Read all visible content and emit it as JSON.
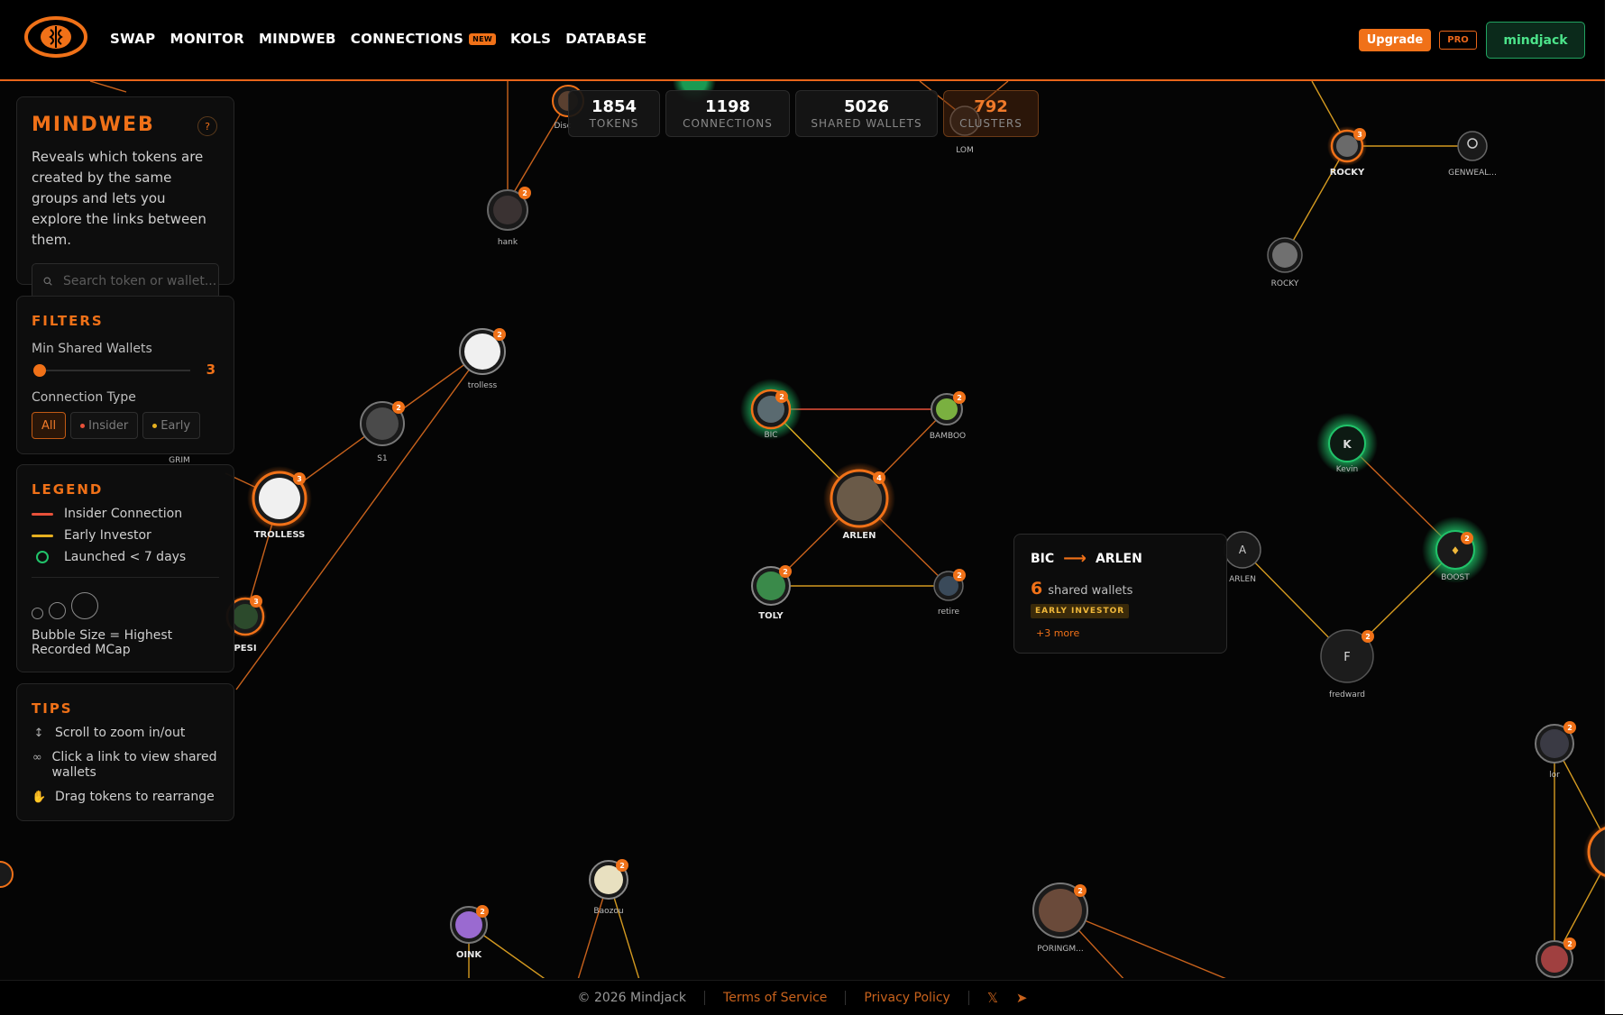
{
  "header": {
    "nav": [
      {
        "label": "SWAP"
      },
      {
        "label": "MONITOR"
      },
      {
        "label": "MINDWEB"
      },
      {
        "label": "CONNECTIONS",
        "badge": "NEW"
      },
      {
        "label": "KOLS"
      },
      {
        "label": "DATABASE"
      }
    ],
    "upgrade_label": "Upgrade",
    "pro_label": "PRO",
    "user_label": "mindjack"
  },
  "stats": [
    {
      "value": "1854",
      "label": "TOKENS"
    },
    {
      "value": "1198",
      "label": "CONNECTIONS"
    },
    {
      "value": "5026",
      "label": "SHARED WALLETS"
    },
    {
      "value": "792",
      "label": "CLUSTERS"
    }
  ],
  "mindweb": {
    "title": "MINDWEB",
    "help": "?",
    "description": "Reveals which tokens are created by the same groups and lets you explore the links between them.",
    "search_placeholder": "Search token or wallet..."
  },
  "filters": {
    "title": "FILTERS",
    "min_shared_label": "Min Shared Wallets",
    "min_shared_value": "3",
    "connection_type_label": "Connection Type",
    "types": [
      {
        "label": "All"
      },
      {
        "label": "Insider"
      },
      {
        "label": "Early"
      }
    ]
  },
  "legend": {
    "title": "LEGEND",
    "items": [
      {
        "label": "Insider Connection"
      },
      {
        "label": "Early Investor"
      },
      {
        "label": "Launched < 7 days"
      }
    ],
    "bubble_note": "Bubble Size = Highest Recorded MCap"
  },
  "tips": {
    "title": "TIPS",
    "items": [
      {
        "label": "Scroll to zoom in/out"
      },
      {
        "label": "Click a link to view shared wallets"
      },
      {
        "label": "Drag tokens to rearrange"
      }
    ]
  },
  "tooltip": {
    "from": "BIC",
    "to": "ARLEN",
    "count": "6",
    "count_label": "shared wallets",
    "tag": "EARLY INVESTOR",
    "more": "+3 more"
  },
  "nodes": {
    "hank": "hank",
    "lom": "LOM",
    "disc": "Disc",
    "rocky1": "ROCKY",
    "genweal": "GENWEAL...",
    "rocky2": "ROCKY",
    "trolless": "trolless",
    "s1": "S1",
    "grim": "GRIM",
    "trolless2": "TROLLESS",
    "pepe": "PESI",
    "bic": "BIC",
    "bamboo": "BAMBOO",
    "arlen": "ARLEN",
    "toly": "TOLY",
    "retire": "retire",
    "kevin": "Kevin",
    "arlen2": "ARLEN",
    "boost": "BOOST",
    "fredward": "fredward",
    "lor": "lor",
    "oink": "OINK",
    "baozou": "Baozou",
    "poringm": "PORINGM..."
  },
  "footer": {
    "copyright": "© 2026 Mindjack",
    "terms": "Terms of Service",
    "privacy": "Privacy Policy"
  },
  "colors": {
    "accent": "#f07118",
    "insider": "#e8513a",
    "early": "#e6b020",
    "new_launch": "#21c36a"
  }
}
